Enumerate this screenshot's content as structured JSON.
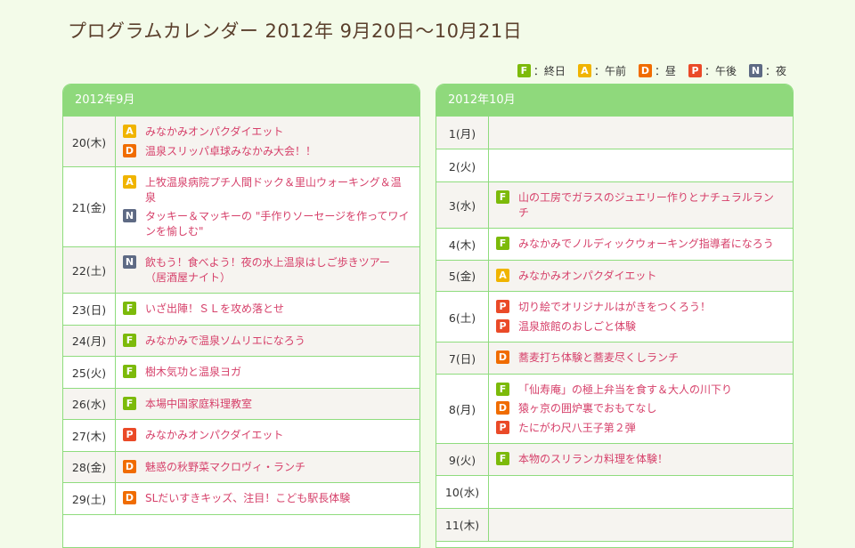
{
  "page": {
    "title": "プログラムカレンダー 2012年 9月20日～10月21日"
  },
  "legend": [
    {
      "code": "F",
      "label": "：終日"
    },
    {
      "code": "A",
      "label": "：午前"
    },
    {
      "code": "D",
      "label": "：昼"
    },
    {
      "code": "P",
      "label": "：午後"
    },
    {
      "code": "N",
      "label": "：夜"
    }
  ],
  "months": [
    {
      "label": "2012年9月",
      "days": [
        {
          "date": "20(木)",
          "events": [
            {
              "code": "A",
              "title": "みなかみオンパクダイエット"
            },
            {
              "code": "D",
              "title": "温泉スリッパ卓球みなかみ大会！！"
            }
          ]
        },
        {
          "date": "21(金)",
          "events": [
            {
              "code": "A",
              "title": "上牧温泉病院プチ人間ドック＆里山ウォーキング＆温泉"
            },
            {
              "code": "N",
              "title": "タッキー＆マッキーの \"手作りソーセージを作ってワインを愉しむ\""
            }
          ]
        },
        {
          "date": "22(土)",
          "events": [
            {
              "code": "N",
              "title": "飲もう！食べよう！夜の水上温泉はしご歩きツアー（居酒屋ナイト）"
            }
          ]
        },
        {
          "date": "23(日)",
          "events": [
            {
              "code": "F",
              "title": "いざ出陣！ＳＬを攻め落とせ"
            }
          ]
        },
        {
          "date": "24(月)",
          "events": [
            {
              "code": "F",
              "title": "みなかみで温泉ソムリエになろう"
            }
          ]
        },
        {
          "date": "25(火)",
          "events": [
            {
              "code": "F",
              "title": "樹木気功と温泉ヨガ"
            }
          ]
        },
        {
          "date": "26(水)",
          "events": [
            {
              "code": "F",
              "title": "本場中国家庭料理教室"
            }
          ]
        },
        {
          "date": "27(木)",
          "events": [
            {
              "code": "P",
              "title": "みなかみオンパクダイエット"
            }
          ]
        },
        {
          "date": "28(金)",
          "events": [
            {
              "code": "D",
              "title": "魅惑の秋野菜マクロヴィ・ランチ"
            }
          ]
        },
        {
          "date": "29(土)",
          "events": [
            {
              "code": "D",
              "title": "SLだいすきキッズ、注目！こども駅長体験"
            }
          ]
        }
      ]
    },
    {
      "label": "2012年10月",
      "days": [
        {
          "date": "1(月)",
          "events": []
        },
        {
          "date": "2(火)",
          "events": []
        },
        {
          "date": "3(水)",
          "events": [
            {
              "code": "F",
              "title": "山の工房でガラスのジュエリー作りとナチュラルランチ"
            }
          ]
        },
        {
          "date": "4(木)",
          "events": [
            {
              "code": "F",
              "title": "みなかみでノルディックウォーキング指導者になろう"
            }
          ]
        },
        {
          "date": "5(金)",
          "events": [
            {
              "code": "A",
              "title": "みなかみオンパクダイエット"
            }
          ]
        },
        {
          "date": "6(土)",
          "events": [
            {
              "code": "P",
              "title": "切り絵でオリジナルはがきをつくろう！"
            },
            {
              "code": "P",
              "title": "温泉旅館のおしごと体験"
            }
          ]
        },
        {
          "date": "7(日)",
          "events": [
            {
              "code": "D",
              "title": "蕎麦打ち体験と蕎麦尽くしランチ"
            }
          ]
        },
        {
          "date": "8(月)",
          "events": [
            {
              "code": "F",
              "title": "「仙寿庵」の極上弁当を食す＆大人の川下り"
            },
            {
              "code": "D",
              "title": "猿ヶ京の囲炉裏でおもてなし"
            },
            {
              "code": "P",
              "title": "たにがわ尺八王子第２弾"
            }
          ]
        },
        {
          "date": "9(火)",
          "events": [
            {
              "code": "F",
              "title": "本物のスリランカ料理を体験！"
            }
          ]
        },
        {
          "date": "10(水)",
          "events": []
        },
        {
          "date": "11(木)",
          "events": []
        }
      ]
    }
  ]
}
